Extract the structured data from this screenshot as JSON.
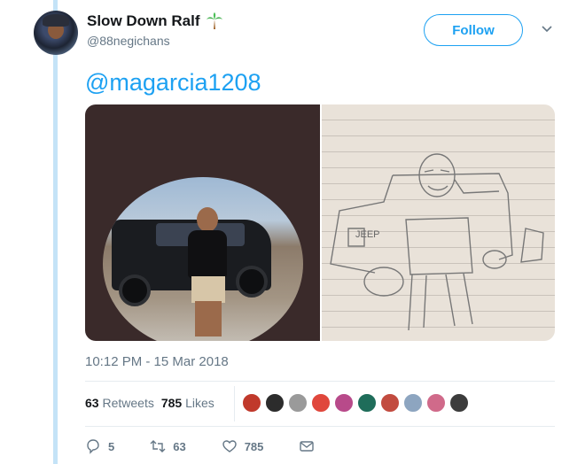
{
  "tweet": {
    "display_name": "Slow Down Ralf",
    "handle": "@88negichans",
    "follow_label": "Follow",
    "mention": "@magarcia1208",
    "timestamp": "10:12 PM - 15 Mar 2018",
    "sketch_label": "JEEP"
  },
  "stats": {
    "retweets_count": "63",
    "retweets_label": "Retweets",
    "likes_count": "785",
    "likes_label": "Likes"
  },
  "actions": {
    "reply_count": "5",
    "retweet_count": "63",
    "like_count": "785"
  },
  "colors": {
    "accent": "#1da1f2",
    "thread_line": "#c4e3f7",
    "muted_text": "#657786"
  },
  "likers": [
    {
      "name": "liker-1",
      "color": "#c0392b"
    },
    {
      "name": "liker-2",
      "color": "#2c2c2c"
    },
    {
      "name": "liker-3",
      "color": "#9a9a9a"
    },
    {
      "name": "liker-4",
      "color": "#e0473c"
    },
    {
      "name": "liker-5",
      "color": "#b84a8a"
    },
    {
      "name": "liker-6",
      "color": "#1f6d5a"
    },
    {
      "name": "liker-7",
      "color": "#c24b3f"
    },
    {
      "name": "liker-8",
      "color": "#8da5c0"
    },
    {
      "name": "liker-9",
      "color": "#d06a8a"
    },
    {
      "name": "liker-10",
      "color": "#3c3c3c"
    }
  ]
}
